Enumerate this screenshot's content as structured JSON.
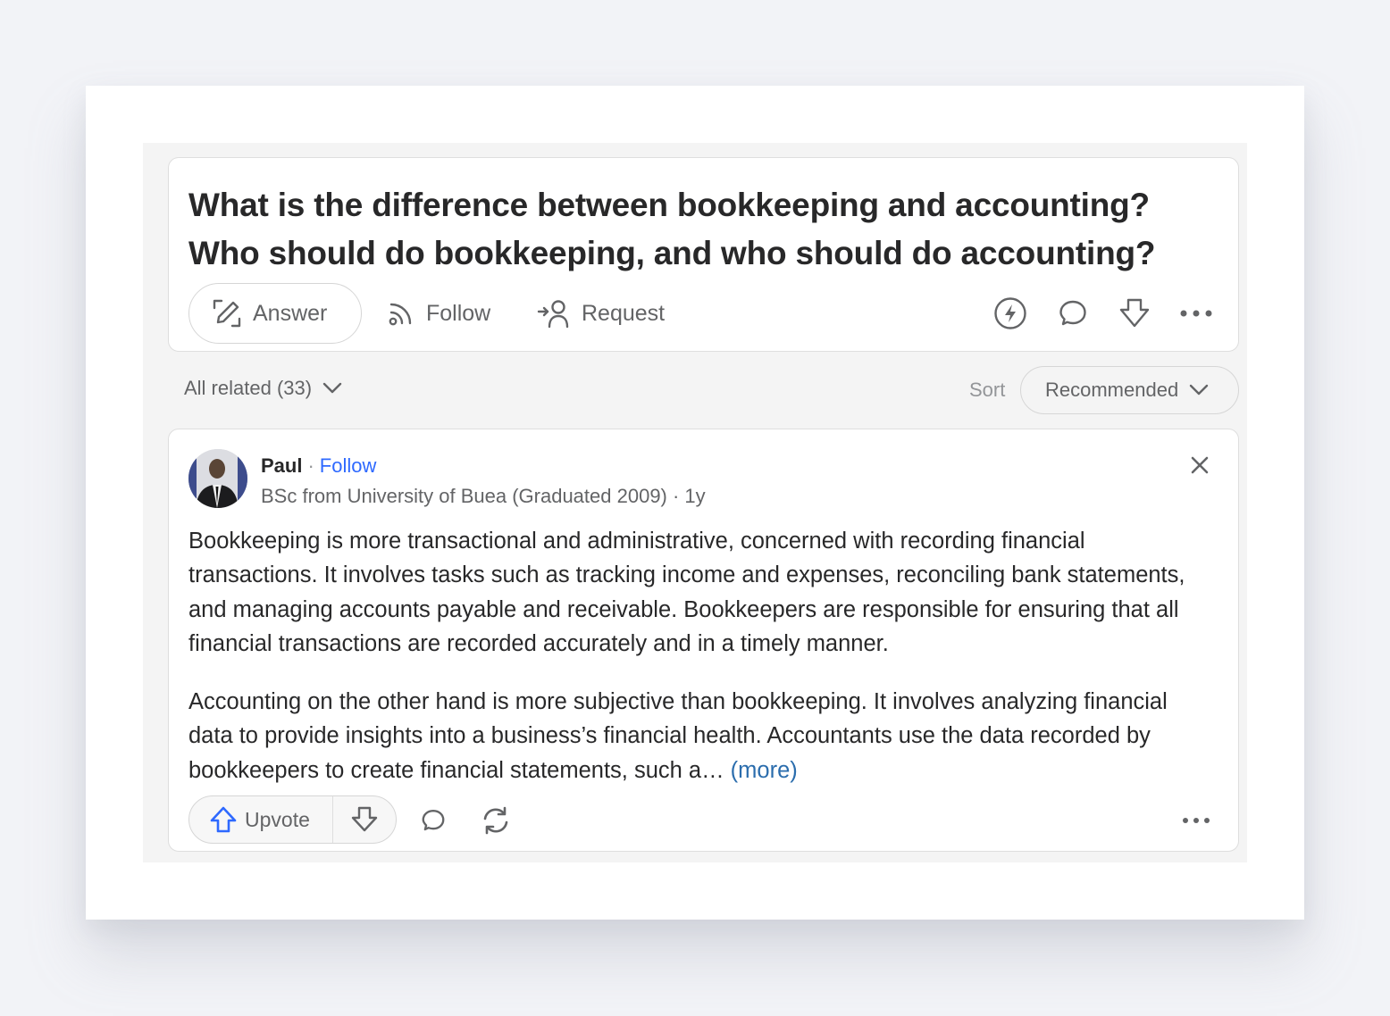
{
  "question": {
    "title_line1": "What is the difference between bookkeeping and accounting?",
    "title_line2": "Who should do bookkeeping, and who should do accounting?",
    "actions": {
      "answer_label": "Answer",
      "follow_label": "Follow",
      "request_label": "Request"
    },
    "icons": {
      "spaces": "lightning-circle-icon",
      "comment": "comment-icon",
      "downvote": "downvote-arrow-icon",
      "more": "more-horizontal-icon"
    }
  },
  "filter": {
    "all_related_label": "All related (33)",
    "sort_label": "Sort",
    "sort_selected": "Recommended"
  },
  "answer": {
    "author": {
      "name": "Paul",
      "separator": "·",
      "follow_label": "Follow",
      "credential": "BSc from University of Buea (Graduated 2009) · 1y"
    },
    "paragraphs": [
      "Bookkeeping is more transactional and administrative, concerned with recording financial transactions. It involves tasks such as tracking income and expenses, reconciling bank statements, and managing accounts payable and receivable. Bookkeepers are responsible for ensuring that all financial transactions are recorded accurately and in a timely manner.",
      "Accounting on the other hand is more subjective than bookkeeping. It involves analyzing financial data to provide insights into a business’s financial health. Accountants use the data recorded by bookkeepers to create financial statements, such a…"
    ],
    "more_label": "(more)",
    "footer": {
      "upvote_label": "Upvote"
    }
  },
  "colors": {
    "accent_blue": "#2e69ff",
    "link_blue": "#2b6dad",
    "text_primary": "#282829",
    "text_secondary": "#636466"
  }
}
